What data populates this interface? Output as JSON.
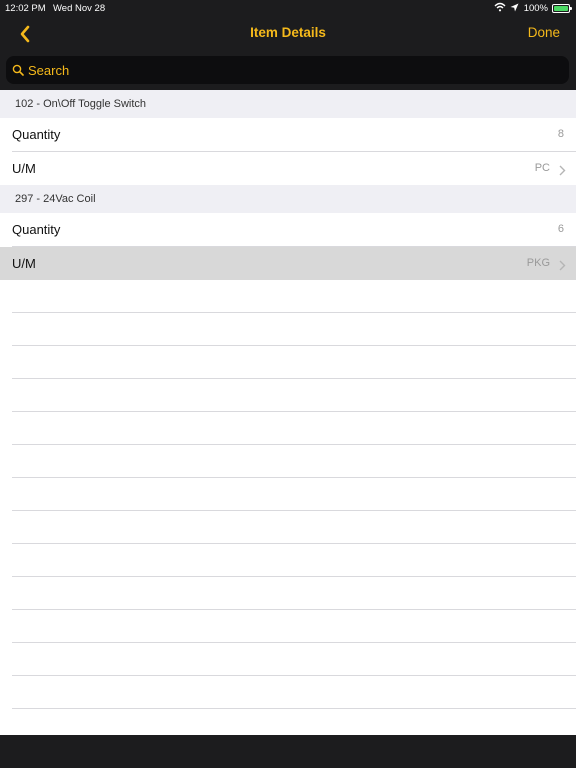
{
  "status_bar": {
    "time": "12:02 PM",
    "date": "Wed Nov 28",
    "battery_pct": "100%"
  },
  "nav": {
    "title": "Item Details",
    "done_label": "Done",
    "accent_color": "#f5b91b"
  },
  "search": {
    "placeholder": "Search"
  },
  "sections": [
    {
      "header": "102 - On\\Off Toggle Switch",
      "rows": [
        {
          "label": "Quantity",
          "value": "8"
        },
        {
          "label": "U/M",
          "value": "PC"
        }
      ]
    },
    {
      "header": "297 - 24Vac Coil",
      "rows": [
        {
          "label": "Quantity",
          "value": "6"
        },
        {
          "label": "U/M",
          "value": "PKG"
        }
      ]
    }
  ]
}
